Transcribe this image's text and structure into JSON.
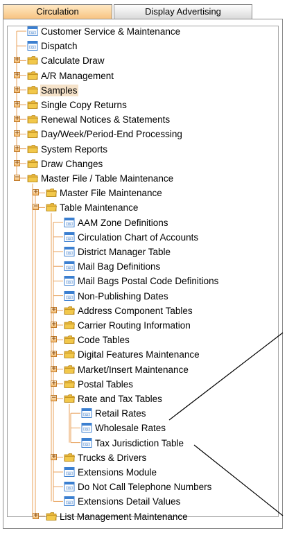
{
  "tabs": [
    {
      "label": "Circulation",
      "active": true
    },
    {
      "label": "Display Advertising",
      "active": false
    }
  ],
  "colors": {
    "active_tab": "#f7c27f",
    "tree_line": "#e8a05a",
    "folder": "#f2c84b",
    "doc_icon": "#3b7fd0",
    "selection": "#f5e2c9"
  },
  "tree": [
    {
      "label": "Customer Service & Maintenance",
      "level": 0,
      "type": "doc",
      "name": "customer-service-maintenance"
    },
    {
      "label": "Dispatch",
      "level": 0,
      "type": "doc",
      "name": "dispatch"
    },
    {
      "label": "Calculate Draw",
      "level": 0,
      "type": "folder",
      "expanded": false,
      "name": "calculate-draw"
    },
    {
      "label": "A/R Management",
      "level": 0,
      "type": "folder",
      "expanded": false,
      "name": "ar-management"
    },
    {
      "label": "Samples",
      "level": 0,
      "type": "folder",
      "expanded": false,
      "selected": true,
      "name": "samples"
    },
    {
      "label": "Single Copy Returns",
      "level": 0,
      "type": "folder",
      "expanded": false,
      "name": "single-copy-returns"
    },
    {
      "label": "Renewal Notices & Statements",
      "level": 0,
      "type": "folder",
      "expanded": false,
      "name": "renewal-notices-statements"
    },
    {
      "label": "Day/Week/Period-End Processing",
      "level": 0,
      "type": "folder",
      "expanded": false,
      "name": "day-week-period-end-processing"
    },
    {
      "label": "System Reports",
      "level": 0,
      "type": "folder",
      "expanded": false,
      "name": "system-reports"
    },
    {
      "label": "Draw Changes",
      "level": 0,
      "type": "folder",
      "expanded": false,
      "name": "draw-changes"
    },
    {
      "label": "Master File / Table Maintenance",
      "level": 0,
      "type": "folder",
      "expanded": true,
      "name": "master-file-table-maintenance"
    },
    {
      "label": "Master File Maintenance",
      "level": 1,
      "type": "folder",
      "expanded": false,
      "name": "master-file-maintenance"
    },
    {
      "label": "Table Maintenance",
      "level": 1,
      "type": "folder",
      "expanded": true,
      "name": "table-maintenance"
    },
    {
      "label": "AAM Zone Definitions",
      "level": 2,
      "type": "doc",
      "name": "aam-zone-definitions"
    },
    {
      "label": "Circulation Chart of Accounts",
      "level": 2,
      "type": "doc",
      "name": "circulation-chart-of-accounts"
    },
    {
      "label": "District Manager Table",
      "level": 2,
      "type": "doc",
      "name": "district-manager-table"
    },
    {
      "label": "Mail Bag Definitions",
      "level": 2,
      "type": "doc",
      "name": "mail-bag-definitions"
    },
    {
      "label": "Mail Bags Postal Code Definitions",
      "level": 2,
      "type": "doc",
      "name": "mail-bags-postal-code-definitions"
    },
    {
      "label": "Non-Publishing Dates",
      "level": 2,
      "type": "doc",
      "name": "non-publishing-dates"
    },
    {
      "label": "Address Component Tables",
      "level": 2,
      "type": "folder",
      "expanded": false,
      "name": "address-component-tables"
    },
    {
      "label": "Carrier Routing Information",
      "level": 2,
      "type": "folder",
      "expanded": false,
      "name": "carrier-routing-information"
    },
    {
      "label": "Code Tables",
      "level": 2,
      "type": "folder",
      "expanded": false,
      "name": "code-tables"
    },
    {
      "label": "Digital Features Maintenance",
      "level": 2,
      "type": "folder",
      "expanded": false,
      "name": "digital-features-maintenance"
    },
    {
      "label": "Market/Insert Maintenance",
      "level": 2,
      "type": "folder",
      "expanded": false,
      "name": "market-insert-maintenance"
    },
    {
      "label": "Postal Tables",
      "level": 2,
      "type": "folder",
      "expanded": false,
      "name": "postal-tables"
    },
    {
      "label": "Rate and Tax Tables",
      "level": 2,
      "type": "folder",
      "expanded": true,
      "name": "rate-and-tax-tables"
    },
    {
      "label": "Retail Rates",
      "level": 3,
      "type": "doc",
      "name": "retail-rates"
    },
    {
      "label": "Wholesale Rates",
      "level": 3,
      "type": "doc",
      "name": "wholesale-rates"
    },
    {
      "label": "Tax Jurisdiction Table",
      "level": 3,
      "type": "doc",
      "name": "tax-jurisdiction-table"
    },
    {
      "label": "Trucks & Drivers",
      "level": 2,
      "type": "folder",
      "expanded": false,
      "name": "trucks-drivers"
    },
    {
      "label": "Extensions Module",
      "level": 2,
      "type": "doc",
      "name": "extensions-module"
    },
    {
      "label": "Do Not Call Telephone Numbers",
      "level": 2,
      "type": "doc",
      "name": "do-not-call-telephone-numbers"
    },
    {
      "label": "Extensions Detail Values",
      "level": 2,
      "type": "doc",
      "name": "extensions-detail-values"
    },
    {
      "label": "List Management Maintenance",
      "level": 1,
      "type": "folder",
      "expanded": false,
      "name": "list-management-maintenance"
    }
  ]
}
